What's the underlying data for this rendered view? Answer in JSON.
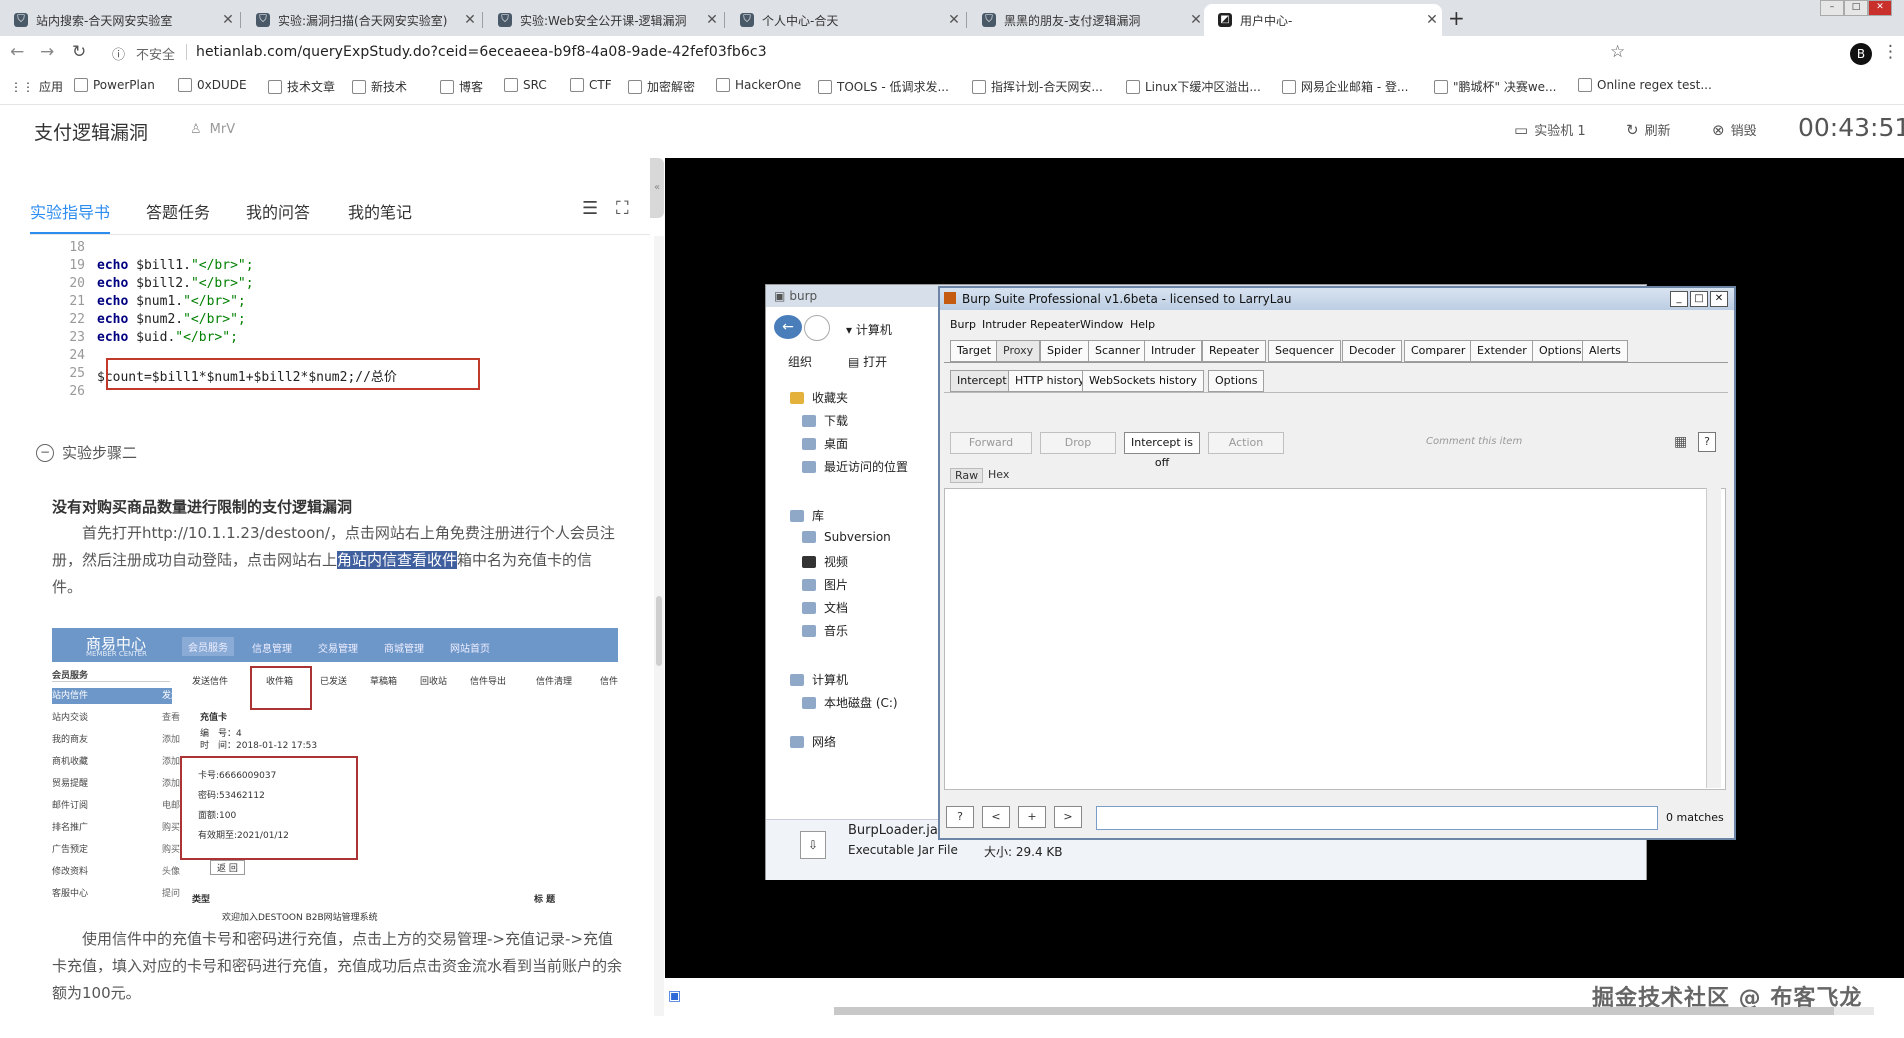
{
  "browser": {
    "tabs": [
      {
        "title": "站内搜索-合天网安实验室",
        "active": false
      },
      {
        "title": "实验:漏洞扫描(合天网安实验室)",
        "active": false
      },
      {
        "title": "实验:Web安全公开课-逻辑漏洞",
        "active": false
      },
      {
        "title": "个人中心-合天",
        "active": false
      },
      {
        "title": "黑黑的朋友-支付逻辑漏洞",
        "active": false
      },
      {
        "title": "用户中心-",
        "active": true
      }
    ],
    "new_tab": "+",
    "address_warning": "不安全",
    "url": "hetianlab.com/queryExpStudy.do?ceid=6eceaeea-b9f8-4a08-9ade-42fef03fb6c3",
    "bookmarks": [
      "应用",
      "PowerPlan",
      "0xDUDE",
      "技术文章",
      "新技术",
      "博客",
      "SRC",
      "CTF",
      "加密解密",
      "HackerOne",
      "TOOLS - 低调求发...",
      "指挥计划-合天网安...",
      "Linux下缓冲区溢出...",
      "网易企业邮箱 - 登...",
      "\"鹏城杯\" 决赛we...",
      "Online regex test..."
    ],
    "profile_initial": "B"
  },
  "lab": {
    "title": "支付逻辑漏洞",
    "user": "MrV",
    "header_buttons": [
      {
        "label": "实验机 1",
        "icon": "monitor-icon"
      },
      {
        "label": "刷新",
        "icon": "refresh-icon"
      },
      {
        "label": "销毁",
        "icon": "destroy-icon"
      }
    ],
    "timer": "00:43:51"
  },
  "left": {
    "tabs": [
      "实验指导书",
      "答题任务",
      "我的问答",
      "我的笔记"
    ],
    "code_lines": [
      {
        "n": "18",
        "text": ""
      },
      {
        "n": "19",
        "kw": "echo",
        "text": " $bill1.",
        "str": "\"</br>\";"
      },
      {
        "n": "20",
        "kw": "echo",
        "text": " $bill2.",
        "str": "\"</br>\";"
      },
      {
        "n": "21",
        "kw": "echo",
        "text": " $num1.",
        "str": "\"</br>\";"
      },
      {
        "n": "22",
        "kw": "echo",
        "text": " $num2.",
        "str": "\"</br>\";"
      },
      {
        "n": "23",
        "kw": "echo",
        "text": " $uid.",
        "str": "\"</br>\";"
      },
      {
        "n": "24",
        "text": ""
      },
      {
        "n": "25",
        "text": "$count=$bill1*$num1+$bill2*$num2;//总价"
      },
      {
        "n": "26",
        "text": ""
      }
    ],
    "step_title": "实验步骤二",
    "section_title": "没有对购买商品数量进行限制的支付逻辑漏洞",
    "para1_before": "首先打开http://10.1.1.23/destoon/，点击网站右上角免费注册进行个人会员注册，然后注册成功自动登陆，点击网站右上",
    "para1_highlight": "角站内信查看收件",
    "para1_after": "箱中名为充值卡的信件。",
    "para2": "使用信件中的充值卡号和密码进行充值，点击上方的交易管理->充值记录->充值卡充值，填入对应的卡号和密码进行充值，充值成功后点击资金流水看到当前账户的余额为100元。",
    "shot": {
      "logo": "商易中心",
      "logo_sub": "MEMBER CENTER",
      "nav": [
        "会员服务",
        "信息管理",
        "交易管理",
        "商城管理",
        "网站首页"
      ],
      "sidebar_title": "会员服务",
      "sidebar": [
        {
          "l": "站内信件",
          "r": "发送"
        },
        {
          "l": "站内交谈",
          "r": "查看"
        },
        {
          "l": "我的商友",
          "r": "添加"
        },
        {
          "l": "商机收藏",
          "r": "添加"
        },
        {
          "l": "贸易提醒",
          "r": "添加"
        },
        {
          "l": "邮件订阅",
          "r": "电邮"
        },
        {
          "l": "排名推广",
          "r": "购买"
        },
        {
          "l": "广告预定",
          "r": "购买"
        },
        {
          "l": "修改资料",
          "r": "头像"
        },
        {
          "l": "客服中心",
          "r": "提问"
        }
      ],
      "menu": [
        "发送信件",
        "收件箱",
        "已发送",
        "草稿箱",
        "回收站",
        "信件导出",
        "信件清理",
        "信件"
      ],
      "mail_title": "充值卡",
      "mail_no": "编　号：4",
      "mail_time": "时　间：2018-01-12 17:53",
      "card": [
        "卡号:6666009037",
        "密码:53462112",
        "面额:100",
        "有效期至:2021/01/12"
      ],
      "back_btn": "返 回",
      "col_type": "类型",
      "col_title": "标 题",
      "row1": "欢迎加入DESTOON B2B网站管理系统"
    }
  },
  "remote": {
    "explorer": {
      "title": "burp",
      "path": "计算机",
      "toolbar": [
        "组织",
        "打开"
      ],
      "tree": [
        {
          "label": "收藏夹",
          "indent": 0
        },
        {
          "label": "下载",
          "indent": 1
        },
        {
          "label": "桌面",
          "indent": 1
        },
        {
          "label": "最近访问的位置",
          "indent": 1
        },
        {
          "label": "库",
          "indent": 0
        },
        {
          "label": "Subversion",
          "indent": 1
        },
        {
          "label": "视频",
          "indent": 1
        },
        {
          "label": "图片",
          "indent": 1
        },
        {
          "label": "文档",
          "indent": 1
        },
        {
          "label": "音乐",
          "indent": 1
        },
        {
          "label": "计算机",
          "indent": 0
        },
        {
          "label": "本地磁盘 (C:)",
          "indent": 1
        },
        {
          "label": "网络",
          "indent": 0
        }
      ],
      "file_name": "BurpLoader.ja",
      "file_type": "Executable Jar File",
      "file_size": "大小: 29.4 KB"
    },
    "burp": {
      "title": "Burp Suite Professional v1.6beta - licensed to LarryLau",
      "menu": [
        "Burp",
        "Intruder",
        "Repeater",
        "Window",
        "Help"
      ],
      "tabs": [
        "Target",
        "Proxy",
        "Spider",
        "Scanner",
        "Intruder",
        "Repeater",
        "Sequencer",
        "Decoder",
        "Comparer",
        "Extender",
        "Options",
        "Alerts"
      ],
      "active_tab": "Proxy",
      "subtabs": [
        "Intercept",
        "HTTP history",
        "WebSockets history",
        "Options"
      ],
      "active_subtab": "Intercept",
      "buttons": [
        "Forward",
        "Drop",
        "Intercept is off",
        "Action"
      ],
      "comment_placeholder": "Comment this item",
      "view_tabs": [
        "Raw",
        "Hex"
      ],
      "bottom_buttons": [
        "?",
        "<",
        "+",
        ">"
      ],
      "matches": "0 matches"
    },
    "watermark": "掘金技术社区 @ 布客飞龙"
  }
}
